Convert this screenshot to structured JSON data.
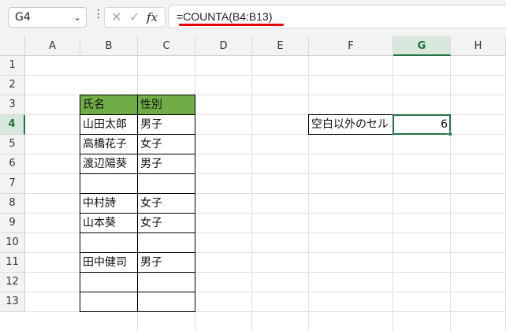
{
  "name_box": {
    "value": "G4"
  },
  "formula_bar": {
    "formula": "=COUNTA(B4:B13)",
    "fx_label": "fx",
    "cancel_symbol": "✕",
    "enter_symbol": "✓"
  },
  "columns": [
    "A",
    "B",
    "C",
    "D",
    "E",
    "F",
    "G",
    "H"
  ],
  "rows": [
    "1",
    "2",
    "3",
    "4",
    "5",
    "6",
    "7",
    "8",
    "9",
    "10",
    "11",
    "12",
    "13"
  ],
  "active": {
    "column": "G",
    "row": "4"
  },
  "table": {
    "headers": {
      "name": "氏名",
      "gender": "性別"
    },
    "rows": [
      {
        "name": "山田太郎",
        "gender": "男子"
      },
      {
        "name": "高橋花子",
        "gender": "女子"
      },
      {
        "name": "渡辺陽葵",
        "gender": "男子"
      },
      {
        "name": "",
        "gender": ""
      },
      {
        "name": "中村詩",
        "gender": "女子"
      },
      {
        "name": "山本葵",
        "gender": "女子"
      },
      {
        "name": "",
        "gender": ""
      },
      {
        "name": "田中健司",
        "gender": "男子"
      },
      {
        "name": "",
        "gender": ""
      },
      {
        "name": "",
        "gender": ""
      }
    ]
  },
  "label_cell": {
    "text": "空白以外のセル"
  },
  "result_cell": {
    "value": "6"
  },
  "colors": {
    "header_fill": "#70ad47",
    "selection": "#217346",
    "underline": "#e60000"
  }
}
